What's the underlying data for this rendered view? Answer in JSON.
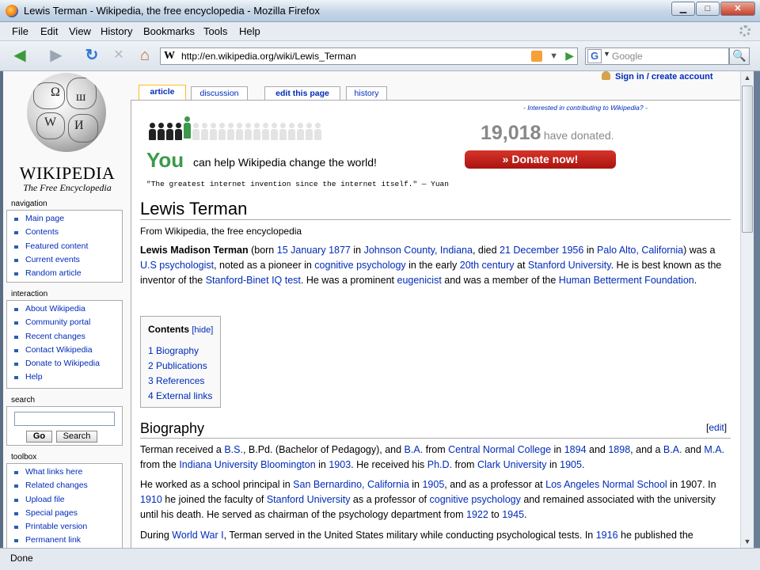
{
  "window": {
    "title": "Lewis Terman - Wikipedia, the free encyclopedia - Mozilla Firefox",
    "min": "▁",
    "max": "□",
    "close": "✕"
  },
  "menu": [
    "File",
    "Edit",
    "View",
    "History",
    "Bookmarks",
    "Tools",
    "Help"
  ],
  "nav": {
    "back": "◀",
    "forward": "▶",
    "reload": "↻",
    "stop": "✕",
    "home": "⌂",
    "url": "http://en.wikipedia.org/wiki/Lewis_Terman",
    "url_icon": "W",
    "search_engine": "G",
    "search_placeholder": "Google",
    "search_go": "🔍",
    "go": "▶"
  },
  "logo": {
    "name": "WIKIPEDIA",
    "tagline": "The Free Encyclopedia"
  },
  "sidebar": {
    "navigation": {
      "title": "navigation",
      "items": [
        "Main page",
        "Contents",
        "Featured content",
        "Current events",
        "Random article"
      ]
    },
    "interaction": {
      "title": "interaction",
      "items": [
        "About Wikipedia",
        "Community portal",
        "Recent changes",
        "Contact Wikipedia",
        "Donate to Wikipedia",
        "Help"
      ]
    },
    "search": {
      "title": "search",
      "go": "Go",
      "search": "Search"
    },
    "toolbox": {
      "title": "toolbox",
      "items": [
        "What links here",
        "Related changes",
        "Upload file",
        "Special pages",
        "Printable version",
        "Permanent link"
      ]
    }
  },
  "user": {
    "login": "Sign in / create account"
  },
  "tabs": {
    "article": "article",
    "discussion": "discussion",
    "edit": "edit this page",
    "history": "history"
  },
  "banner": {
    "interested": "- Interested in contributing to Wikipedia? -",
    "you": "You",
    "can_help": "can help Wikipedia change the world!",
    "quote": "\"The greatest internet invention since the internet itself.\" — Yuan",
    "count": "19,018",
    "donated": "have donated.",
    "donate": "» Donate now!"
  },
  "article": {
    "title": "Lewis Terman",
    "from": "From Wikipedia, the free encyclopedia",
    "intro": {
      "name": "Lewis Madison Terman",
      "t1": " (born ",
      "born_date": "15 January 1877",
      "t2": " in ",
      "born_place": "Johnson County, Indiana",
      "t3": ", died ",
      "died_date": "21 December 1956",
      "t4": " in ",
      "died_place": "Palo Alto, California",
      "t5": ") was a ",
      "us_psych": "U.S psychologist",
      "t6": ", noted as a pioneer in ",
      "cog": "cognitive psychology",
      "t7": " in the early ",
      "century": "20th century",
      "t8": " at ",
      "stanford": "Stanford University",
      "t9": ". He is best known as the inventor of the ",
      "iq": "Stanford-Binet IQ test",
      "t10": ". He was a prominent ",
      "eug": "eugenicist",
      "t11": " and was a member of the ",
      "hbf": "Human Betterment Foundation",
      "t12": "."
    },
    "toc": {
      "title": "Contents",
      "hide": "[hide]",
      "items": [
        "1 Biography",
        "2 Publications",
        "3 References",
        "4 External links"
      ]
    },
    "biography": {
      "heading": "Biography",
      "edit_open": "[",
      "edit": "edit",
      "edit_close": "]"
    },
    "p1": {
      "a": "Terman received a ",
      "bs": "B.S.",
      "b": ", B.Pd. (Bachelor of Pedagogy), and ",
      "ba": "B.A.",
      "c": " from ",
      "cnc": "Central Normal College",
      "d": " in ",
      "y1894": "1894",
      "e": " and ",
      "y1898": "1898",
      "f": ", and a ",
      "ba2": "B.A.",
      "g": " and ",
      "ma": "M.A.",
      "h": " from the ",
      "iub": "Indiana University Bloomington",
      "i": " in ",
      "y1903": "1903",
      "j": ". He received his ",
      "phd": "Ph.D.",
      "k": " from ",
      "clark": "Clark University",
      "l": " in ",
      "y1905": "1905",
      "m": "."
    },
    "p2": {
      "a": "He worked as a school principal in ",
      "sb": "San Bernardino, California",
      "b": " in ",
      "y1905": "1905",
      "c": ", and as a professor at ",
      "lans": "Los Angeles Normal School",
      "d": " in 1907. In ",
      "y1910": "1910",
      "e": " he joined the faculty of ",
      "stanford": "Stanford University",
      "f": " as a professor of ",
      "cog": "cognitive psychology",
      "g": " and remained associated with the university until his death. He served as chairman of the psychology department from ",
      "y1922": "1922",
      "h": " to ",
      "y1945": "1945",
      "i": "."
    },
    "p3": {
      "a": "During ",
      "ww1": "World War I",
      "b": ", Terman served in the United States military while conducting psychological tests. In ",
      "y1916": "1916",
      "c": " he published the"
    }
  },
  "status": {
    "text": "Done"
  }
}
